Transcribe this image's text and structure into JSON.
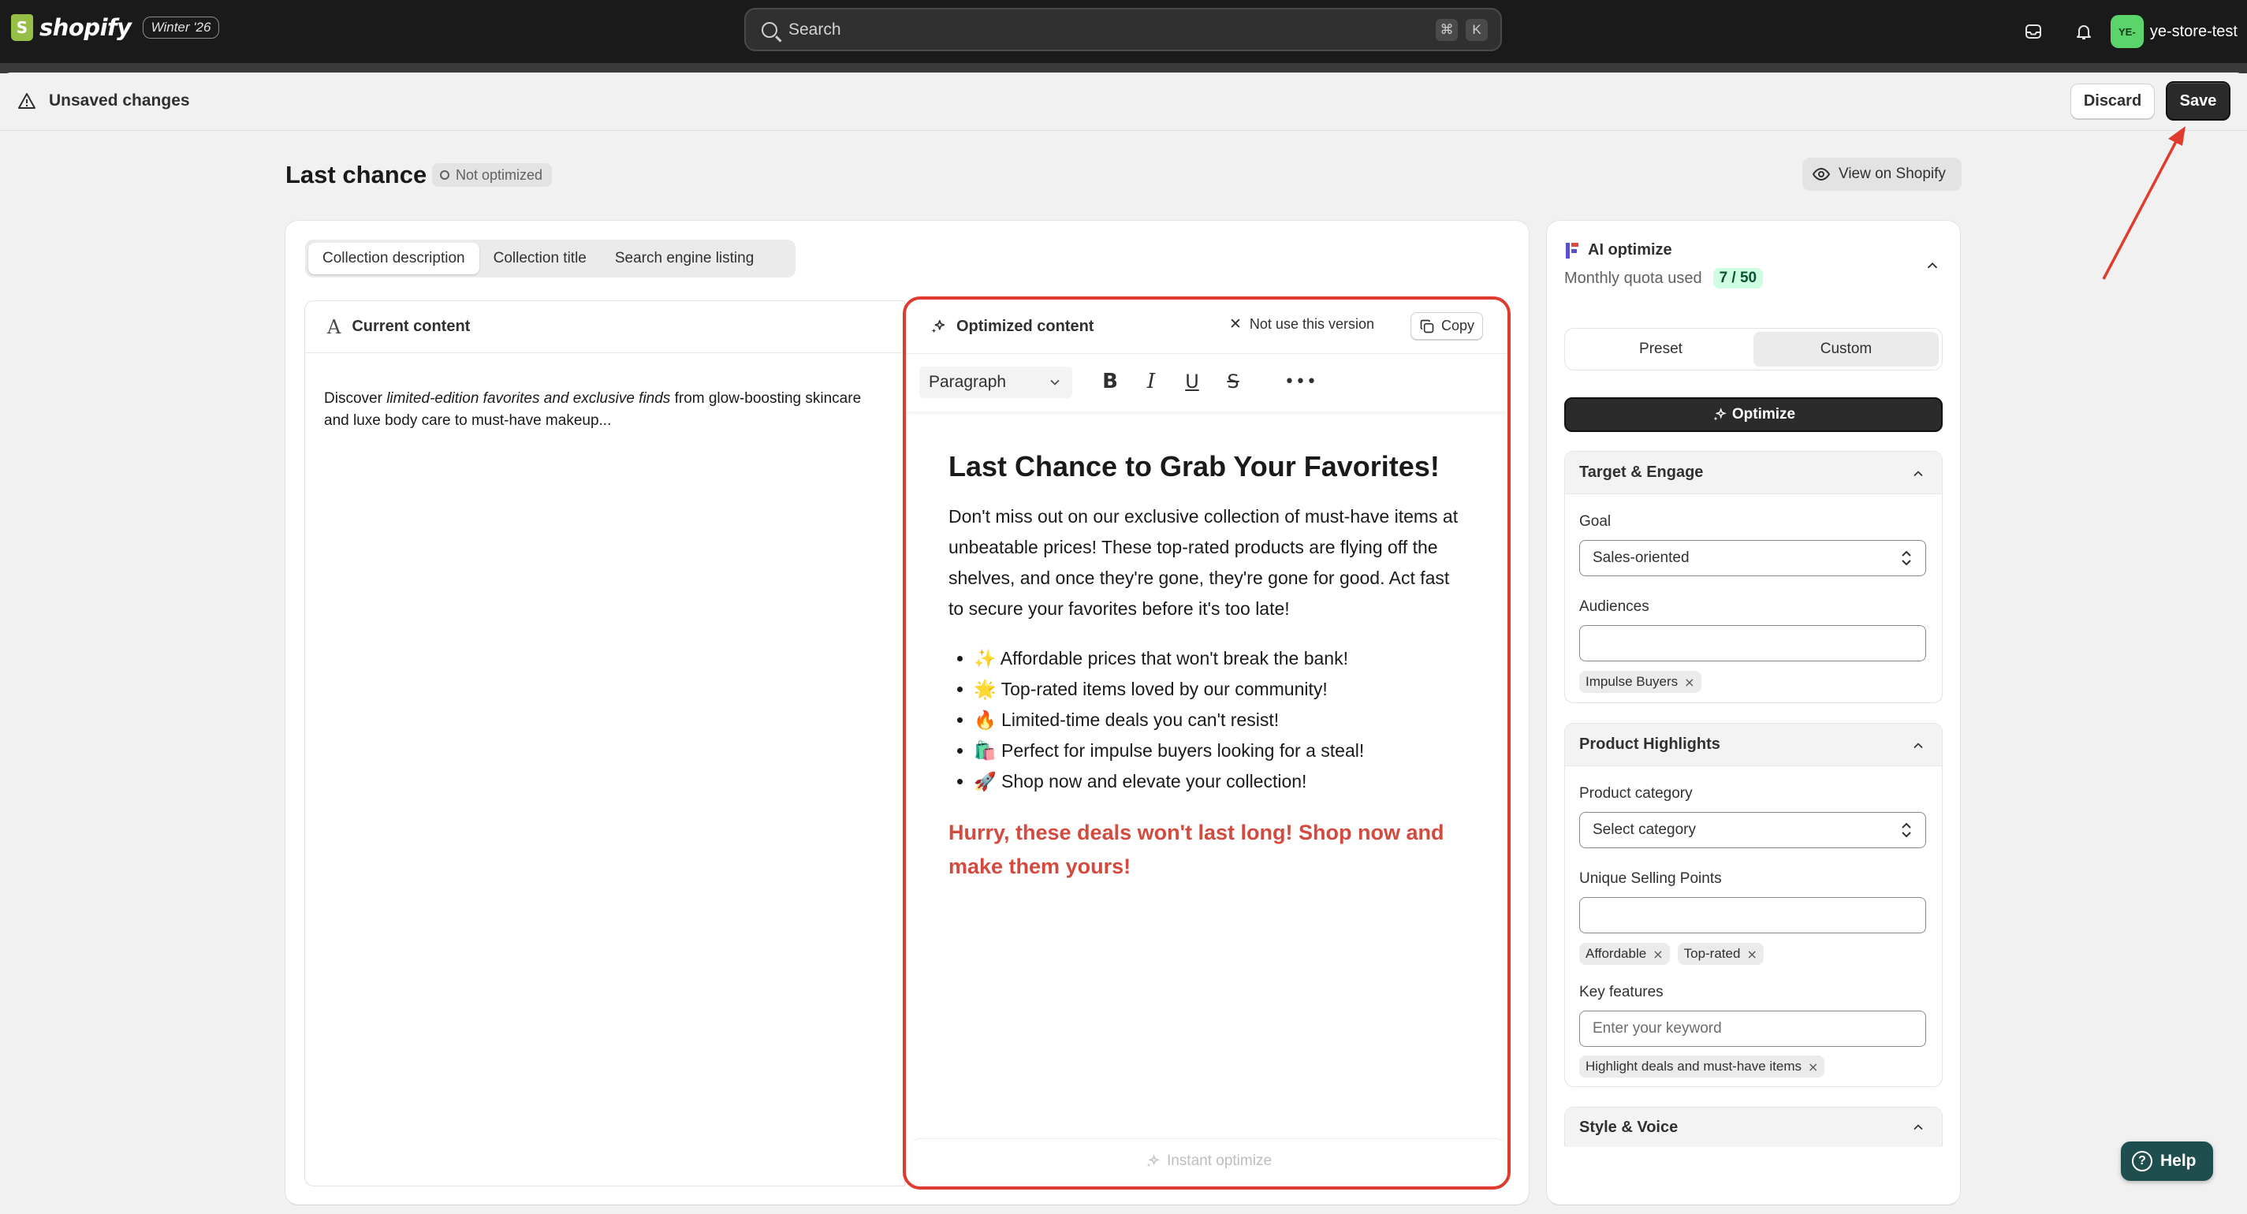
{
  "topbar": {
    "brand": "shopify",
    "edition_badge": "Winter '26",
    "search_placeholder": "Search",
    "shortcut_keys": [
      "⌘",
      "K"
    ],
    "avatar_initials": "YE-",
    "store_name": "ye-store-test"
  },
  "save_bar": {
    "message": "Unsaved changes",
    "discard_label": "Discard",
    "save_label": "Save"
  },
  "page": {
    "title": "Last chance",
    "status": "Not optimized",
    "view_button": "View on Shopify"
  },
  "tabs": [
    {
      "label": "Collection description",
      "active": true
    },
    {
      "label": "Collection title",
      "active": false
    },
    {
      "label": "Search engine listing",
      "active": false
    }
  ],
  "current": {
    "heading": "Current content",
    "text_before": "Discover ",
    "text_italic": "limited-edition favorites and exclusive finds",
    "text_after": " from glow-boosting skincare and luxe body care to must-have makeup..."
  },
  "optimized": {
    "heading": "Optimized content",
    "not_use_label": "Not use this version",
    "copy_label": "Copy",
    "block_format": "Paragraph",
    "title": "Last Chance to Grab Your Favorites!",
    "paragraph": "Don't miss out on our exclusive collection of must-have items at unbeatable prices! These top-rated products are flying off the shelves, and once they're gone, they're gone for good. Act fast to secure your favorites before it's too late!",
    "bullets": [
      "✨ Affordable prices that won't break the bank!",
      "🌟 Top-rated items loved by our community!",
      "🔥 Limited-time deals you can't resist!",
      "🛍️ Perfect for impulse buyers looking for a steal!",
      "🚀 Shop now and elevate your collection!"
    ],
    "cta": "Hurry, these deals won't last long! Shop now and make them yours!",
    "cta_color": "#d44a3e",
    "instant_label": "Instant optimize"
  },
  "ai": {
    "title": "AI optimize",
    "quota_label": "Monthly quota used",
    "quota_value": "7 / 50",
    "modes": [
      {
        "label": "Preset",
        "active": false
      },
      {
        "label": "Custom",
        "active": true
      }
    ],
    "optimize_label": "Optimize",
    "target": {
      "heading": "Target & Engage",
      "goal_label": "Goal",
      "goal_value": "Sales-oriented",
      "audiences_label": "Audiences",
      "audiences_value": "",
      "audience_tags": [
        "Impulse Buyers"
      ]
    },
    "highlights": {
      "heading": "Product Highlights",
      "category_label": "Product category",
      "category_value": "Select category",
      "usp_label": "Unique Selling Points",
      "usp_value": "",
      "usp_tags": [
        "Affordable",
        "Top-rated"
      ],
      "features_label": "Key features",
      "features_placeholder": "Enter your keyword",
      "features_tags": [
        "Highlight deals and must-have items"
      ]
    },
    "style": {
      "heading": "Style & Voice"
    }
  },
  "help_label": "Help",
  "colors": {
    "highlight_border": "#e03b2e",
    "topbar": "#1a1a1a",
    "quota_badge": "#cdfee1"
  }
}
